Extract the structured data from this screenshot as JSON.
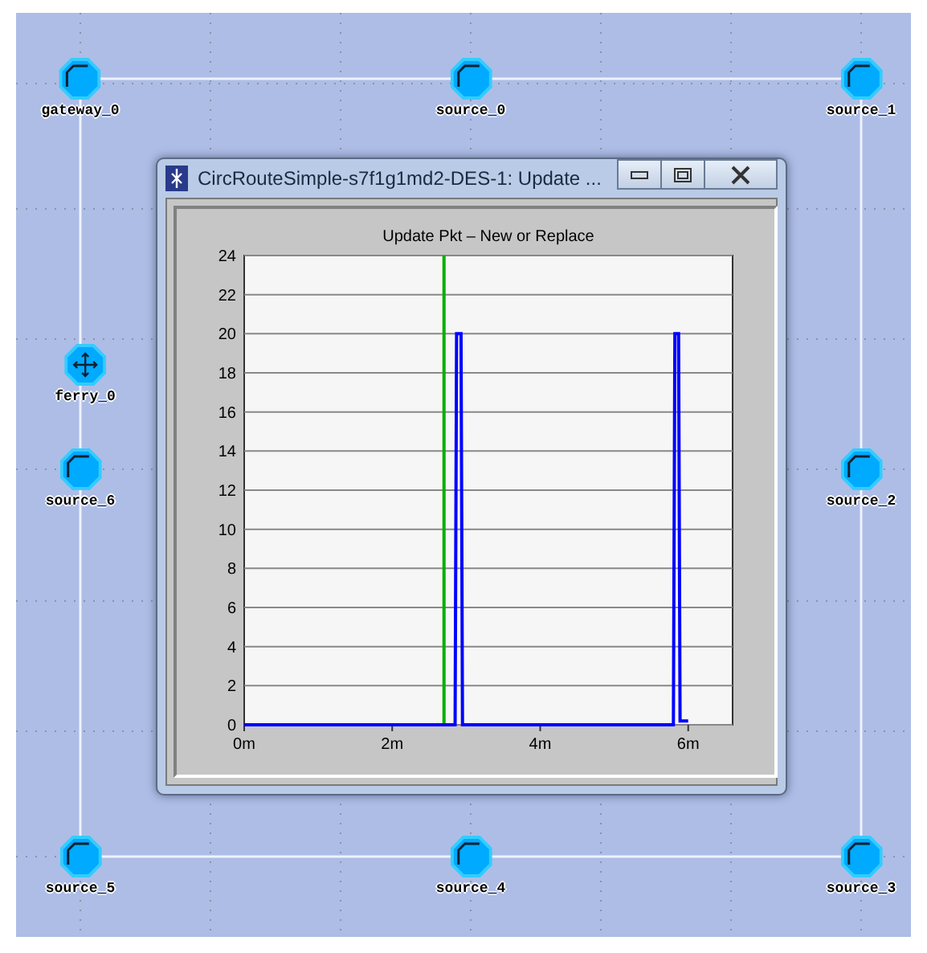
{
  "canvas": {
    "nodes": [
      {
        "label": "gateway_0",
        "kind": "host"
      },
      {
        "label": "source_0",
        "kind": "host"
      },
      {
        "label": "source_1",
        "kind": "host"
      },
      {
        "label": "ferry_0",
        "kind": "mobile"
      },
      {
        "label": "source_6",
        "kind": "host"
      },
      {
        "label": "source_2",
        "kind": "host"
      },
      {
        "label": "source_5",
        "kind": "host"
      },
      {
        "label": "source_4",
        "kind": "host"
      },
      {
        "label": "source_3",
        "kind": "host"
      }
    ]
  },
  "window": {
    "title": "CircRouteSimple-s7f1g1md2-DES-1: Update ...",
    "chart_data": {
      "type": "line",
      "title": "Update Pkt – New or Replace",
      "xlim": [
        0,
        6.6
      ],
      "ylim": [
        0,
        24
      ],
      "xticks": [
        {
          "value": 0,
          "label": "0m"
        },
        {
          "value": 2,
          "label": "2m"
        },
        {
          "value": 4,
          "label": "4m"
        },
        {
          "value": 6,
          "label": "6m"
        }
      ],
      "yticks": [
        0,
        2,
        4,
        6,
        8,
        10,
        12,
        14,
        16,
        18,
        20,
        22,
        24
      ],
      "x": [
        0,
        2.85,
        2.87,
        2.93,
        2.95,
        5.8,
        5.82,
        5.87,
        5.89,
        6.0
      ],
      "series": [
        {
          "color": "#0000ff",
          "values": [
            0,
            0,
            20,
            20,
            0,
            0,
            20,
            20,
            0.2,
            0.2
          ]
        }
      ],
      "grid": true,
      "ref_lines": [
        {
          "axis": "x",
          "value": 2.7,
          "color": "#00b000"
        }
      ]
    }
  }
}
